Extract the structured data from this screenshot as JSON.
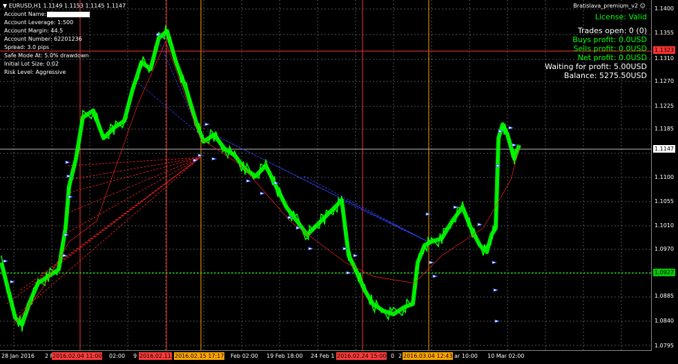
{
  "header": {
    "symbol_line": "EURUSD,H1  1.1149 1.1153 1.1145 1.1147",
    "expert_name": "Bratislava_premium_v2"
  },
  "account_info": [
    "Account Name:",
    "Account Leverage: 1:500",
    "Account Margin: 44.5",
    "Account Number: 62201236",
    "Spread: 3.0 pips",
    "Safe Mode At: 5.0% drawdown",
    "Initial Lot Size: 0.02",
    "Risk Level: Aggressive"
  ],
  "status": {
    "license": "License: Valid",
    "trades_open": "Trades open: 0 (0)",
    "buys_profit": "Buys profit: 0.0USD",
    "sells_profit": "Sells profit: 0.0USD",
    "net_profit": "Net profit: 0.0USD",
    "waiting": "Waiting for profit: 5.00USD",
    "balance": "Balance: 5275.50USD"
  },
  "price_axis": [
    "1.1400",
    "1.1355",
    "1.1310",
    "1.1270",
    "1.1225",
    "1.1185",
    "1.1140",
    "1.1100",
    "1.1055",
    "1.1010",
    "1.0970",
    "1.0925",
    "1.0885",
    "1.0840",
    "1.0795"
  ],
  "price_tags": {
    "red_level": "1.1323",
    "current": "1.1147",
    "green_level": "1.0927"
  },
  "time_axis": {
    "labels": [
      "28 Jan 2016",
      "2 F",
      "02:00",
      "9",
      "Feb 02:00",
      "19 Feb 18:00",
      "24 Feb 1",
      "0",
      "2",
      "ar 10:00",
      "10 Mar 02:00"
    ],
    "badges": [
      {
        "text": "2016.02.04 11:00",
        "color": "#ff3b3b"
      },
      {
        "text": "2016.02.11",
        "color": "#ff3b3b"
      },
      {
        "text": "2016.02.15 17:17",
        "color": "#ffa500"
      },
      {
        "text": "2016.02.24 15:00",
        "color": "#ff3b3b"
      },
      {
        "text": "2016.03.04 12:43",
        "color": "#ffa500"
      }
    ]
  },
  "colors": {
    "candles": "#00ff00",
    "grid": "#555555",
    "red_line": "#ff3333",
    "orange_line": "#ffa500",
    "green_level": "#00ff00",
    "blue_dash": "#3344ff",
    "red_dash": "#ff2222",
    "license": "#00ff00",
    "profit": "#00ff00"
  }
}
